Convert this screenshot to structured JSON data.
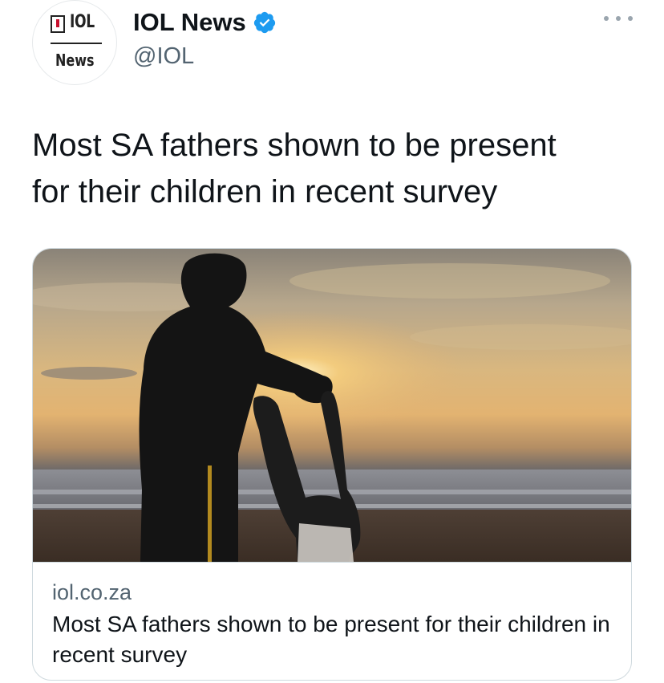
{
  "account": {
    "avatar_logo_top": "IOL",
    "avatar_logo_bottom": "News",
    "display_name": "IOL News",
    "handle": "@IOL",
    "verified": true,
    "verified_color": "#1d9bf0"
  },
  "menu": {
    "icon": "more-horizontal-icon"
  },
  "tweet": {
    "text_line_1": "Most SA fathers shown to be present",
    "text_line_2": "for their children in recent survey"
  },
  "card": {
    "image_description_icon": "photo",
    "domain": "iol.co.za",
    "title": "Most SA fathers shown to be present for their children in recent survey"
  },
  "colors": {
    "text_primary": "#0f1419",
    "text_secondary": "#536471",
    "border": "#cfd9de",
    "brand_red": "#c8102e"
  }
}
